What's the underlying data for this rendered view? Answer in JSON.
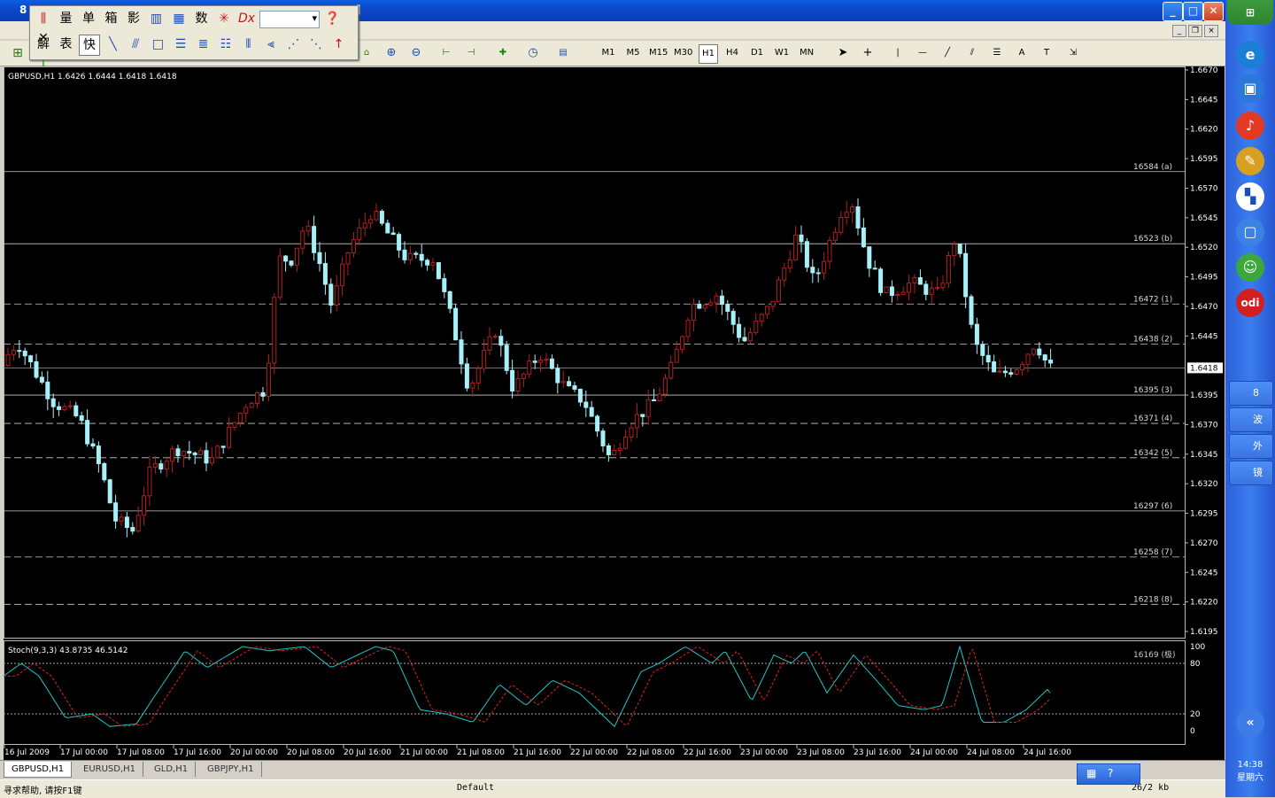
{
  "window": {
    "title": "8",
    "title_suffix": "]"
  },
  "chart": {
    "symbol_header": "GBPUSD,H1  1.6426 1.6444 1.6418 1.6418",
    "current_price": "1.6418",
    "price_ticks": [
      "1.6670",
      "1.6645",
      "1.6620",
      "1.6595",
      "1.6570",
      "1.6545",
      "1.6520",
      "1.6495",
      "1.6470",
      "1.6445",
      "1.6418",
      "1.6395",
      "1.6370",
      "1.6345",
      "1.6320",
      "1.6295",
      "1.6270",
      "1.6245",
      "1.6220",
      "1.6195"
    ],
    "levels": [
      {
        "label": "16584 (a)",
        "price": 1.6584,
        "style": "solid"
      },
      {
        "label": "16523 (b)",
        "price": 1.6523,
        "style": "solid"
      },
      {
        "label": "16472 (1)",
        "price": 1.6472,
        "style": "dash"
      },
      {
        "label": "16438 (2)",
        "price": 1.6438,
        "style": "dash"
      },
      {
        "label": "16395 (3)",
        "price": 1.6395,
        "style": "solid"
      },
      {
        "label": "16371 (4)",
        "price": 1.6371,
        "style": "dash"
      },
      {
        "label": "16342 (5)",
        "price": 1.6342,
        "style": "dash"
      },
      {
        "label": "16297 (6)",
        "price": 1.6297,
        "style": "solid"
      },
      {
        "label": "16258 (7)",
        "price": 1.6258,
        "style": "dash"
      },
      {
        "label": "16218 (8)",
        "price": 1.6218,
        "style": "dash"
      }
    ],
    "stoch_header": "Stoch(9,3,3) 43.8735 46.5142",
    "stoch_level_label": "16169 (极)",
    "stoch_ticks": [
      "100",
      "80",
      "20",
      "0"
    ],
    "time_labels": [
      "16 Jul 2009",
      "17 Jul 00:00",
      "17 Jul 08:00",
      "17 Jul 16:00",
      "20 Jul 00:00",
      "20 Jul 08:00",
      "20 Jul 16:00",
      "21 Jul 00:00",
      "21 Jul 08:00",
      "21 Jul 16:00",
      "22 Jul 00:00",
      "22 Jul 08:00",
      "22 Jul 16:00",
      "23 Jul 00:00",
      "23 Jul 08:00",
      "23 Jul 16:00",
      "24 Jul 00:00",
      "24 Jul 08:00",
      "24 Jul 16:00"
    ],
    "colors": {
      "bull": "#B41E1E",
      "bear": "#A8F0F8",
      "main": "#1EC8C8",
      "signal": "#E02020",
      "level": "#C8C8C8"
    }
  },
  "timeframes": [
    "M1",
    "M5",
    "M15",
    "M30",
    "H1",
    "H4",
    "D1",
    "W1",
    "MN"
  ],
  "active_timeframe": "H1",
  "floatbar": {
    "row1": [
      "量",
      "单",
      "箱",
      "影",
      "数"
    ],
    "row2": [
      "解",
      "表",
      "快"
    ]
  },
  "tabs": [
    "GBPUSD,H1",
    "EURUSD,H1",
    "GLD,H1",
    "GBPJPY,H1"
  ],
  "status": {
    "help": "寻求帮助, 请按F1键",
    "profile": "Default",
    "traffic": "26/2 kb"
  },
  "taskbar": {
    "tasks": [
      "8",
      "波",
      "外",
      "镜"
    ],
    "clock_time": "14:38",
    "clock_day": "星期六"
  }
}
